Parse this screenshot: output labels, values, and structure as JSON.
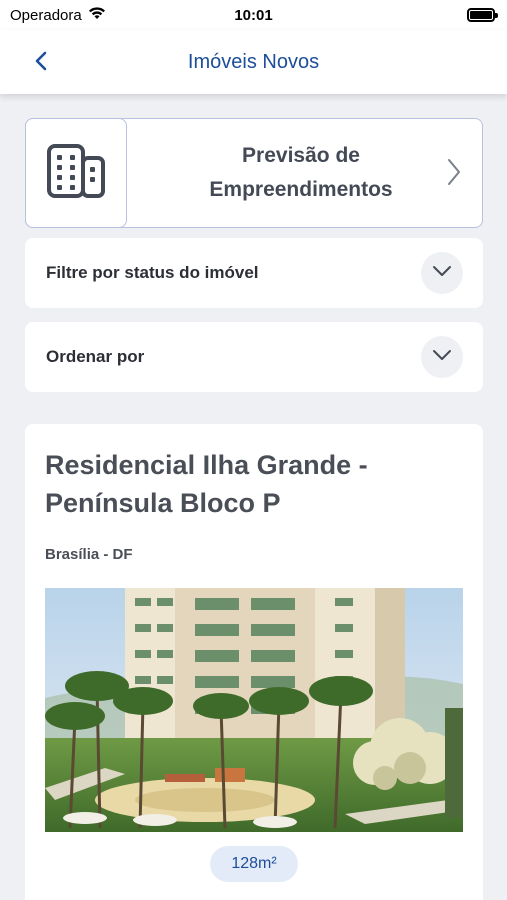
{
  "status_bar": {
    "carrier": "Operadora",
    "time": "10:01"
  },
  "nav": {
    "title": "Imóveis Novos",
    "back_icon": "chevron-left-icon"
  },
  "forecast": {
    "title_line1": "Previsão de",
    "title_line2": "Empreendimentos",
    "icon": "building-icon"
  },
  "filters": {
    "status_label": "Filtre por status do imóvel",
    "sort_label": "Ordenar por"
  },
  "property": {
    "title_line1": "Residencial Ilha Grande -",
    "title_line2": "Península Bloco P",
    "location": "Brasília  - DF",
    "area": "128m²"
  },
  "colors": {
    "accent": "#1d4e9a",
    "background": "#eef0f4",
    "card_border": "#b8c1e0"
  }
}
